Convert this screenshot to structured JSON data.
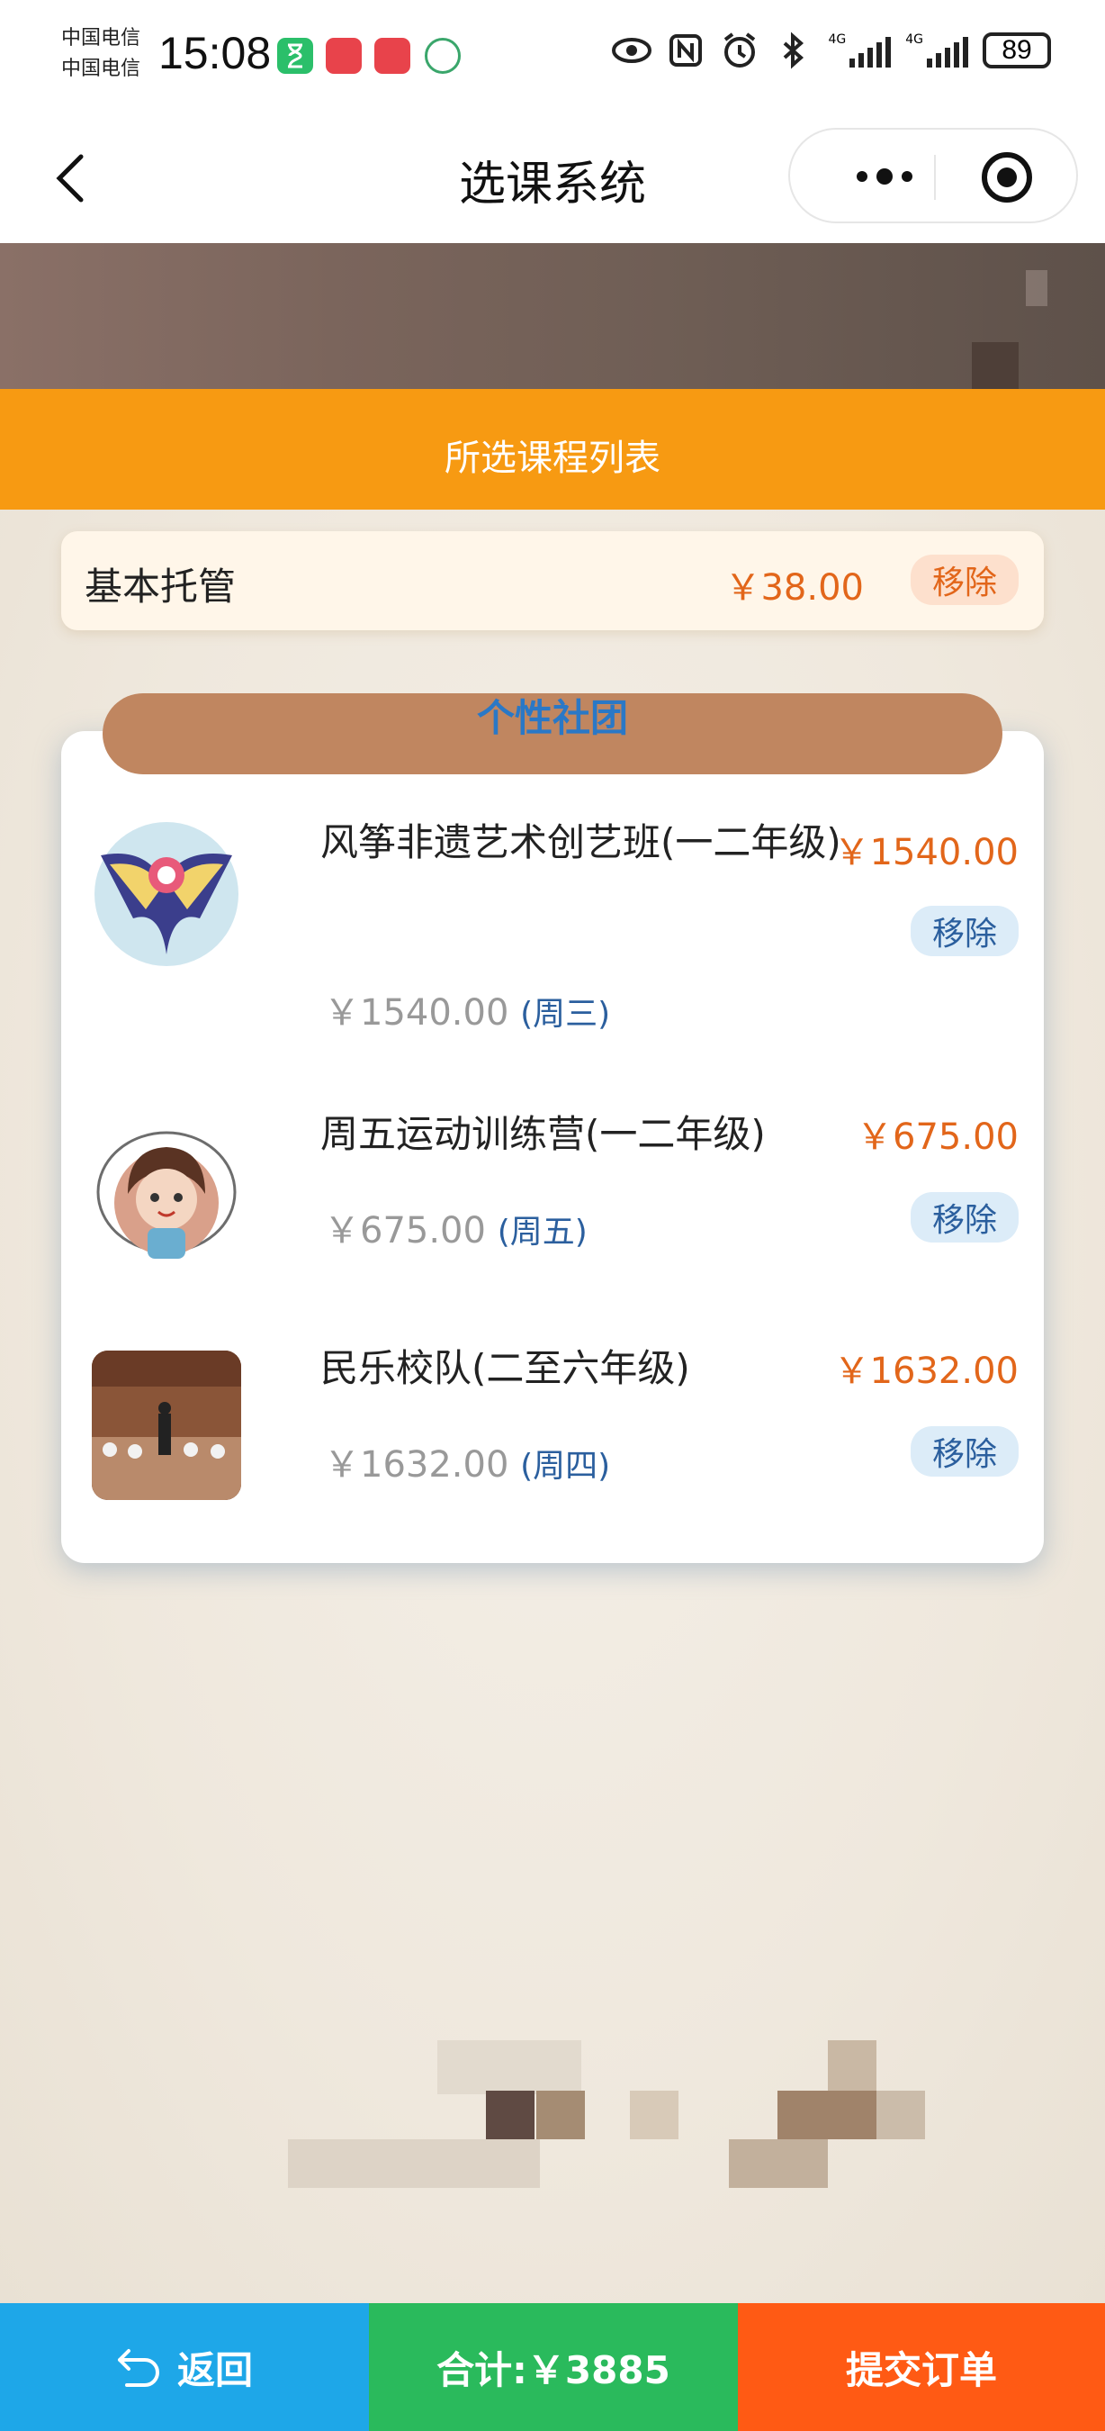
{
  "status_bar": {
    "carrier1": "中国电信",
    "carrier2": "中国电信",
    "time": "15:08",
    "signal1_label": "4G",
    "signal2_label": "4G",
    "battery": "89"
  },
  "nav": {
    "title": "选课系统"
  },
  "selected_header": "所选课程列表",
  "basic": {
    "name": "基本托管",
    "price": "￥38.00",
    "remove_label": "移除"
  },
  "club_section_title": "个性社团",
  "courses": [
    {
      "name": "风筝非遗艺术创艺班(一二年级)",
      "price": "￥1540.00",
      "sub_price": "￥1540.00",
      "day": "(周三)",
      "remove_label": "移除",
      "thumb_icon": "kite-image"
    },
    {
      "name": "周五运动训练营(一二年级)",
      "price": "￥675.00",
      "sub_price": "￥675.00",
      "day": "(周五)",
      "remove_label": "移除",
      "thumb_icon": "jump-rope-girl-image"
    },
    {
      "name": "民乐校队(二至六年级)",
      "price": "￥1632.00",
      "sub_price": "￥1632.00",
      "day": "(周四)",
      "remove_label": "移除",
      "thumb_icon": "orchestra-photo"
    }
  ],
  "bottom_bar": {
    "back_label": "返回",
    "total_label": "合计:￥3885",
    "submit_label": "提交订单"
  },
  "colors": {
    "orange": "#f79a12",
    "price": "#e2661a",
    "back_btn": "#1ea7e8",
    "total_btn": "#2aba5c",
    "submit_btn": "#ff5a14",
    "club_tab": "#c08660",
    "club_title": "#2a78c6"
  }
}
